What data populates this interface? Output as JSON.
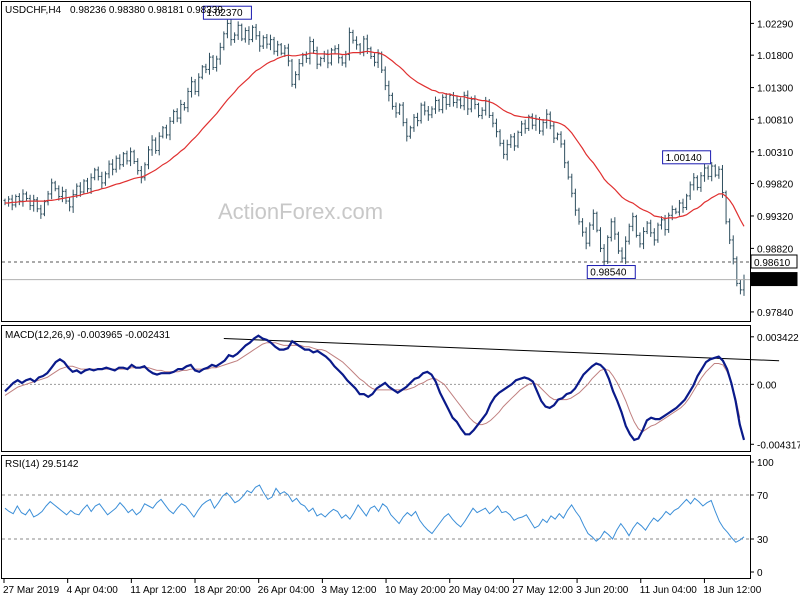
{
  "header": {
    "symbol": "USDCHF,H4",
    "ohlc": "0.98236 0.98380 0.98181 0.98339"
  },
  "watermark": "ActionForex.com",
  "colors": {
    "candle": "#2f4f5f",
    "ma": "#e03030",
    "macd": "#0a1a8a",
    "signal": "#c08080",
    "rsi": "#3c8fd8",
    "frame": "#000000",
    "grid_dash": "#555555",
    "label_box": "#1a1ab0"
  },
  "chart_data": [
    {
      "type": "candlestick",
      "pane": "price",
      "ylim": [
        0.977,
        1.0262
      ],
      "y_ticks": [
        "1.02290",
        "1.01800",
        "1.01300",
        "1.00810",
        "1.00310",
        "0.99820",
        "0.99320",
        "0.98820",
        "0.98330",
        "0.97840"
      ],
      "y_tick_values": [
        1.0229,
        1.018,
        1.013,
        1.0081,
        1.0031,
        0.9982,
        0.9932,
        0.9882,
        0.9833,
        0.9784
      ],
      "annotations": [
        {
          "text": "1.02370",
          "index": 62,
          "value": 1.0237
        },
        {
          "text": "1.00140",
          "index": 190,
          "value": 1.0014
        },
        {
          "text": "0.98540",
          "index": 169,
          "value": 0.9854
        }
      ],
      "hline": {
        "label": "0.98610",
        "value": 0.9861
      },
      "current": {
        "label": "0.98339",
        "value": 0.98339
      },
      "ma_label": "",
      "closes": [
        0.9952,
        0.9958,
        0.9949,
        0.9962,
        0.9955,
        0.9966,
        0.9959,
        0.9948,
        0.9957,
        0.9943,
        0.9935,
        0.9954,
        0.9966,
        0.9983,
        0.9974,
        0.9962,
        0.997,
        0.9955,
        0.9946,
        0.9965,
        0.9978,
        0.9969,
        0.9986,
        0.9974,
        0.9991,
        1.0003,
        0.9993,
        0.9983,
        0.9997,
        1.0012,
        1.0004,
        1.0021,
        1.0011,
        1.0028,
        1.0017,
        1.0031,
        1.0016,
        1.0002,
        0.9991,
        1.0011,
        1.0034,
        1.0049,
        1.0033,
        1.0055,
        1.0068,
        1.0057,
        1.0078,
        1.0093,
        1.0083,
        1.0104,
        1.0099,
        1.0124,
        1.0139,
        1.0124,
        1.0146,
        1.0162,
        1.0158,
        1.0177,
        1.0161,
        1.0174,
        1.0192,
        1.0213,
        1.0229,
        1.0204,
        1.0211,
        1.0226,
        1.0205,
        1.0218,
        1.0204,
        1.0223,
        1.021,
        1.0194,
        1.0207,
        1.0197,
        1.0204,
        1.0186,
        1.0196,
        1.0183,
        1.0191,
        1.0171,
        1.0135,
        1.015,
        1.0167,
        1.018,
        1.0175,
        1.0201,
        1.0187,
        1.0166,
        1.0175,
        1.0182,
        1.0168,
        1.0188,
        1.019,
        1.0176,
        1.0168,
        1.0181,
        1.0215,
        1.0203,
        1.0196,
        1.0184,
        1.0205,
        1.019,
        1.0178,
        1.0169,
        1.0182,
        1.0157,
        1.0133,
        1.0118,
        1.0101,
        1.0091,
        1.0103,
        1.0076,
        1.0055,
        1.0068,
        1.0084,
        1.0079,
        1.0103,
        1.0094,
        1.0088,
        1.0097,
        1.011,
        1.0096,
        1.0115,
        1.0104,
        1.0118,
        1.0107,
        1.0111,
        1.0102,
        1.0118,
        1.0097,
        1.0112,
        1.0104,
        1.0087,
        1.0095,
        1.0109,
        1.0087,
        1.0075,
        1.0062,
        1.0044,
        1.0027,
        1.0042,
        1.0054,
        1.004,
        1.0061,
        1.0074,
        1.0067,
        1.0085,
        1.0072,
        1.0081,
        1.0063,
        1.0076,
        1.0089,
        1.0071,
        1.0052,
        1.0058,
        1.0043,
        1.0014,
        0.9992,
        0.9967,
        0.9941,
        0.9923,
        0.9907,
        0.989,
        0.9918,
        0.9936,
        0.991,
        0.9882,
        0.9862,
        0.9899,
        0.9923,
        0.9904,
        0.9878,
        0.9867,
        0.9893,
        0.9916,
        0.9931,
        0.9902,
        0.9889,
        0.9908,
        0.9921,
        0.9906,
        0.9895,
        0.9918,
        0.9926,
        0.9911,
        0.9933,
        0.9942,
        0.9938,
        0.9952,
        0.9945,
        0.9963,
        0.998,
        0.9991,
        0.9976,
        0.9994,
        1.0006,
        0.9993,
        1.0009,
        0.9995,
        1.0004,
        0.9968,
        0.9923,
        0.9895,
        0.9866,
        0.9828,
        0.9818,
        0.9834
      ],
      "ma": [
        0.9952,
        0.9952,
        0.9953,
        0.9953,
        0.9954,
        0.9954,
        0.9955,
        0.9955,
        0.9955,
        0.9955,
        0.9955,
        0.9955,
        0.9956,
        0.9956,
        0.9957,
        0.9958,
        0.9959,
        0.996,
        0.9961,
        0.9962,
        0.9963,
        0.9964,
        0.9966,
        0.9967,
        0.9969,
        0.9971,
        0.9972,
        0.9974,
        0.9975,
        0.9977,
        0.9979,
        0.9981,
        0.9982,
        0.9984,
        0.9986,
        0.9988,
        0.999,
        0.9991,
        0.9992,
        0.9994,
        0.9997,
        1.0,
        1.0003,
        1.0007,
        1.0011,
        1.0014,
        1.0018,
        1.0023,
        1.0027,
        1.0032,
        1.0036,
        1.0042,
        1.0048,
        1.0053,
        1.0059,
        1.0066,
        1.0072,
        1.0078,
        1.0084,
        1.009,
        1.0097,
        1.0104,
        1.0111,
        1.0117,
        1.0123,
        1.013,
        1.0135,
        1.014,
        1.0145,
        1.0151,
        1.0156,
        1.0159,
        1.0163,
        1.0167,
        1.017,
        1.0172,
        1.0175,
        1.0177,
        1.0179,
        1.018,
        1.0179,
        1.0179,
        1.018,
        1.0181,
        1.0181,
        1.0183,
        1.0183,
        1.0182,
        1.0182,
        1.0182,
        1.0181,
        1.0182,
        1.0182,
        1.0182,
        1.0181,
        1.0181,
        1.0183,
        1.0184,
        1.0184,
        1.0184,
        1.0185,
        1.0186,
        1.0185,
        1.0184,
        1.0184,
        1.0182,
        1.0179,
        1.0175,
        1.0171,
        1.0166,
        1.0162,
        1.0157,
        1.0151,
        1.0146,
        1.0142,
        1.0138,
        1.0135,
        1.0132,
        1.0129,
        1.0126,
        1.0125,
        1.0122,
        1.0122,
        1.012,
        1.012,
        1.0118,
        1.0117,
        1.0116,
        1.0116,
        1.0114,
        1.0113,
        1.0113,
        1.0111,
        1.011,
        1.011,
        1.0108,
        1.0106,
        1.0103,
        1.0099,
        1.0095,
        1.0092,
        1.009,
        1.0087,
        1.0086,
        1.0085,
        1.0084,
        1.0084,
        1.0083,
        1.0082,
        1.0081,
        1.008,
        1.008,
        1.0079,
        1.0077,
        1.0076,
        1.0074,
        1.0071,
        1.0066,
        1.006,
        1.0052,
        1.0044,
        1.0036,
        1.0027,
        1.002,
        1.0014,
        1.0006,
        0.9998,
        0.9989,
        0.9983,
        0.9978,
        0.9973,
        0.9967,
        0.9961,
        0.9957,
        0.9954,
        0.9952,
        0.9948,
        0.9944,
        0.9941,
        0.9939,
        0.9936,
        0.9932,
        0.9931,
        0.993,
        0.9928,
        0.9929,
        0.9929,
        0.9929,
        0.9931,
        0.9932,
        0.9934,
        0.9938,
        0.9942,
        0.9944,
        0.9948,
        0.9953,
        0.9956,
        0.996,
        0.9963,
        0.9966,
        0.9966,
        0.9962,
        0.9956,
        0.9948,
        0.9937,
        0.9926,
        0.9916
      ]
    },
    {
      "type": "line",
      "pane": "macd",
      "label": "MACD(12,26,9) -0.003965 -0.002431",
      "ylim": [
        -0.0048,
        0.0042
      ],
      "y_ticks": [
        "0.003422",
        "0.00",
        "-0.004317"
      ],
      "y_tick_values": [
        0.003422,
        0.0,
        -0.004317
      ],
      "trendline": [
        [
          61,
          0.0033
        ],
        [
          213,
          0.0017
        ]
      ],
      "macd_values": [
        -0.0005,
        -0.0002,
        0.0001,
        0.0003,
        0.0001,
        0.0003,
        0.0004,
        0.0002,
        0.0005,
        0.0006,
        0.0008,
        0.0012,
        0.0016,
        0.0018,
        0.0016,
        0.0012,
        0.0009,
        0.001,
        0.0008,
        0.001,
        0.0011,
        0.001,
        0.0011,
        0.0011,
        0.0012,
        0.0011,
        0.001,
        0.0012,
        0.0012,
        0.0011,
        0.0014,
        0.0012,
        0.0012,
        0.0013,
        0.001,
        0.0008,
        0.0007,
        0.0008,
        0.0008,
        0.0008,
        0.0009,
        0.0011,
        0.0011,
        0.0013,
        0.0014,
        0.001,
        0.0009,
        0.0011,
        0.0012,
        0.0014,
        0.0013,
        0.0015,
        0.0017,
        0.0021,
        0.002,
        0.0022,
        0.0025,
        0.0028,
        0.003,
        0.0033,
        0.0035,
        0.0033,
        0.0032,
        0.003,
        0.0027,
        0.0025,
        0.0025,
        0.0026,
        0.0031,
        0.0029,
        0.0027,
        0.0025,
        0.0025,
        0.0023,
        0.0024,
        0.0022,
        0.002,
        0.0017,
        0.0013,
        0.001,
        0.0007,
        0.0003,
        0.0,
        -0.0003,
        -0.0007,
        -0.0007,
        -0.0009,
        -0.0007,
        -0.0003,
        -0.0001,
        0.0001,
        -0.0002,
        -0.0004,
        -0.0006,
        -0.0004,
        -0.0002,
        0.0001,
        0.0004,
        0.0005,
        0.0008,
        0.0009,
        0.0007,
        0.0002,
        -0.0006,
        -0.0012,
        -0.0018,
        -0.0024,
        -0.0027,
        -0.0032,
        -0.0036,
        -0.0036,
        -0.0033,
        -0.0029,
        -0.0025,
        -0.0021,
        -0.0014,
        -0.0009,
        -0.0006,
        -0.0004,
        -0.0002,
        0.0,
        0.0003,
        0.0004,
        0.0005,
        0.0004,
        0.0002,
        -0.0005,
        -0.0012,
        -0.0016,
        -0.0017,
        -0.0015,
        -0.0011,
        -0.001,
        -0.0007,
        -0.0006,
        -0.0003,
        0.0002,
        0.0007,
        0.001,
        0.0013,
        0.0015,
        0.0014,
        0.0011,
        0.0004,
        -0.0005,
        -0.0012,
        -0.002,
        -0.003,
        -0.0036,
        -0.004,
        -0.0039,
        -0.0033,
        -0.0026,
        -0.0024,
        -0.0025,
        -0.0025,
        -0.0023,
        -0.0021,
        -0.0019,
        -0.0017,
        -0.0014,
        -0.0011,
        -0.0006,
        -0.0001,
        0.0006,
        0.0011,
        0.0016,
        0.0018,
        0.0019,
        0.002,
        0.0017,
        0.0011,
        0.0001,
        -0.0012,
        -0.0029,
        -0.004
      ],
      "signal_values": [
        -0.0008,
        -0.0006,
        -0.0004,
        -0.0002,
        -0.0001,
        0.0,
        0.0001,
        0.0002,
        0.0003,
        0.0004,
        0.0005,
        0.0007,
        0.0009,
        0.0011,
        0.0012,
        0.0013,
        0.0013,
        0.0012,
        0.0011,
        0.0011,
        0.0011,
        0.0011,
        0.0011,
        0.0011,
        0.0011,
        0.0011,
        0.0011,
        0.0011,
        0.0011,
        0.0011,
        0.0012,
        0.0012,
        0.0012,
        0.0012,
        0.0012,
        0.0011,
        0.001,
        0.001,
        0.0009,
        0.0009,
        0.0009,
        0.0009,
        0.001,
        0.001,
        0.0011,
        0.0011,
        0.0011,
        0.0011,
        0.0011,
        0.0012,
        0.0012,
        0.0013,
        0.0014,
        0.0015,
        0.0016,
        0.0017,
        0.0019,
        0.0021,
        0.0023,
        0.0025,
        0.0027,
        0.0029,
        0.003,
        0.003,
        0.003,
        0.0029,
        0.0028,
        0.0028,
        0.0028,
        0.0028,
        0.0028,
        0.0027,
        0.0027,
        0.0026,
        0.0025,
        0.0025,
        0.0024,
        0.0022,
        0.002,
        0.0018,
        0.0016,
        0.0013,
        0.001,
        0.0007,
        0.0004,
        0.0002,
        -0.0001,
        -0.0003,
        -0.0004,
        -0.0004,
        -0.0004,
        -0.0004,
        -0.0004,
        -0.0004,
        -0.0004,
        -0.0004,
        -0.0003,
        -0.0002,
        0.0,
        0.0001,
        0.0003,
        0.0004,
        0.0004,
        0.0002,
        0.0,
        -0.0004,
        -0.0008,
        -0.0012,
        -0.0016,
        -0.002,
        -0.0024,
        -0.0027,
        -0.0029,
        -0.0029,
        -0.0028,
        -0.0026,
        -0.0023,
        -0.002,
        -0.0016,
        -0.0013,
        -0.001,
        -0.0007,
        -0.0004,
        -0.0002,
        0.0,
        0.0001,
        0.0,
        -0.0003,
        -0.0006,
        -0.0009,
        -0.0011,
        -0.0011,
        -0.0011,
        -0.0011,
        -0.001,
        -0.0008,
        -0.0006,
        -0.0003,
        0.0,
        0.0004,
        0.0007,
        0.001,
        0.0011,
        0.001,
        0.0006,
        0.0001,
        -0.0005,
        -0.0012,
        -0.002,
        -0.0027,
        -0.0032,
        -0.0034,
        -0.0032,
        -0.003,
        -0.0029,
        -0.0027,
        -0.0025,
        -0.0023,
        -0.0021,
        -0.0019,
        -0.0017,
        -0.0014,
        -0.001,
        -0.0005,
        0.0,
        0.0005,
        0.0009,
        0.0012,
        0.0015,
        0.0015,
        0.0014,
        0.0009,
        0.0001,
        -0.001,
        -0.0024
      ]
    },
    {
      "type": "line",
      "pane": "rsi",
      "label": "RSI(14) 29.5142",
      "ylim": [
        0,
        100
      ],
      "y_ticks": [
        "100",
        "70",
        "30",
        "0"
      ],
      "y_tick_values": [
        100,
        70,
        30,
        0
      ],
      "levels": [
        70,
        30
      ],
      "values": [
        58,
        55,
        53,
        60,
        54,
        52,
        57,
        50,
        52,
        55,
        60,
        64,
        61,
        58,
        55,
        52,
        56,
        53,
        52,
        57,
        61,
        55,
        60,
        62,
        57,
        52,
        55,
        58,
        63,
        59,
        54,
        57,
        52,
        55,
        62,
        60,
        58,
        63,
        66,
        61,
        56,
        53,
        58,
        62,
        60,
        55,
        50,
        56,
        61,
        64,
        66,
        58,
        63,
        69,
        72,
        68,
        63,
        65,
        69,
        74,
        72,
        77,
        79,
        72,
        66,
        68,
        76,
        71,
        73,
        70,
        64,
        67,
        62,
        60,
        55,
        58,
        51,
        53,
        50,
        54,
        57,
        55,
        49,
        52,
        48,
        54,
        61,
        56,
        51,
        58,
        60,
        55,
        62,
        59,
        52,
        48,
        44,
        50,
        54,
        51,
        55,
        47,
        42,
        38,
        35,
        40,
        45,
        50,
        53,
        48,
        44,
        41,
        46,
        52,
        58,
        54,
        56,
        58,
        53,
        56,
        60,
        54,
        55,
        52,
        47,
        49,
        50,
        52,
        46,
        40,
        42,
        48,
        45,
        51,
        48,
        53,
        49,
        56,
        61,
        55,
        50,
        42,
        35,
        32,
        28,
        31,
        37,
        34,
        30,
        38,
        44,
        39,
        33,
        40,
        45,
        42,
        38,
        44,
        49,
        46,
        50,
        55,
        52,
        56,
        58,
        62,
        66,
        62,
        67,
        64,
        60,
        63,
        65,
        55,
        46,
        40,
        36,
        31,
        27,
        29,
        32
      ]
    }
  ],
  "x_axis": {
    "labels": [
      "27 Mar 2019",
      "4 Apr 04:00",
      "11 Apr 12:00",
      "18 Apr 20:00",
      "26 Apr 04:00",
      "3 May 12:00",
      "10 May 20:00",
      "20 May 04:00",
      "27 May 12:00",
      "3 Jun 20:00",
      "11 Jun 04:00",
      "18 Jun 12:00"
    ]
  }
}
